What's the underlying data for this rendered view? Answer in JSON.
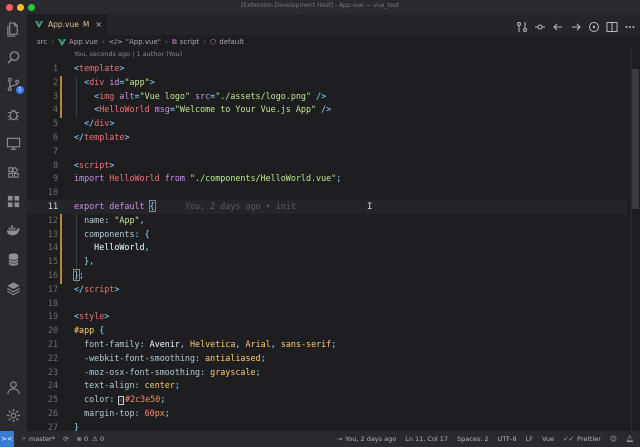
{
  "window": {
    "title": "[Extension Development Host] - App.vue — vue_test"
  },
  "colors": {
    "accent": "#3a7bd5",
    "modified": "#e2c08d",
    "git_gutter": "#b08c3a"
  },
  "activity_bar": {
    "icons": [
      "files-icon",
      "search-icon",
      "source-control-icon",
      "debug-icon",
      "remote-explorer-icon",
      "extensions-icon",
      "grid-icon",
      "docker-icon",
      "database-icon",
      "layers-icon",
      "account-icon",
      "settings-gear-icon"
    ],
    "source_control_badge": "1"
  },
  "tab": {
    "name": "App.vue",
    "modified": "M",
    "close": "×"
  },
  "breadcrumb": {
    "parts": [
      "src",
      "App.vue",
      "\"App.vue\"",
      "script",
      "default"
    ],
    "element_prefix": "</>",
    "script_icon": "⧉",
    "default_icon": "⬡"
  },
  "editor": {
    "blame_header": "You, seconds ago | 1 author (You)",
    "current_line": 11,
    "inline_blame": "You, 2 days ago • init",
    "lines": [
      {
        "n": "1",
        "tokens": [
          [
            "<",
            "t-punc"
          ],
          [
            "template",
            "t-tag"
          ],
          [
            ">",
            "t-punc"
          ]
        ]
      },
      {
        "n": "2",
        "tokens": [
          [
            "  ",
            ""
          ],
          [
            "<",
            "t-punc"
          ],
          [
            "div",
            "t-tag"
          ],
          [
            " id",
            "t-attr"
          ],
          [
            "=",
            "t-punc"
          ],
          [
            "\"app\"",
            "t-str"
          ],
          [
            ">",
            "t-punc"
          ]
        ]
      },
      {
        "n": "3",
        "tokens": [
          [
            "    ",
            ""
          ],
          [
            "<",
            "t-punc"
          ],
          [
            "img",
            "t-tag"
          ],
          [
            " alt",
            "t-attr"
          ],
          [
            "=",
            "t-punc"
          ],
          [
            "\"Vue logo\"",
            "t-str"
          ],
          [
            " src",
            "t-attr"
          ],
          [
            "=",
            "t-punc"
          ],
          [
            "\"./assets/logo.png\"",
            "t-str"
          ],
          [
            " />",
            "t-punc"
          ]
        ]
      },
      {
        "n": "4",
        "tokens": [
          [
            "    ",
            ""
          ],
          [
            "<",
            "t-punc"
          ],
          [
            "HelloWorld",
            "t-tag"
          ],
          [
            " msg",
            "t-attr"
          ],
          [
            "=",
            "t-punc"
          ],
          [
            "\"Welcome to Your Vue.js App\"",
            "t-str"
          ],
          [
            " />",
            "t-punc"
          ]
        ]
      },
      {
        "n": "5",
        "tokens": [
          [
            "  ",
            ""
          ],
          [
            "</",
            "t-punc"
          ],
          [
            "div",
            "t-tag"
          ],
          [
            ">",
            "t-punc"
          ]
        ]
      },
      {
        "n": "6",
        "tokens": [
          [
            "</",
            "t-punc"
          ],
          [
            "template",
            "t-tag"
          ],
          [
            ">",
            "t-punc"
          ]
        ]
      },
      {
        "n": "7",
        "tokens": []
      },
      {
        "n": "8",
        "tokens": [
          [
            "<",
            "t-punc"
          ],
          [
            "script",
            "t-tag"
          ],
          [
            ">",
            "t-punc"
          ]
        ]
      },
      {
        "n": "9",
        "tokens": [
          [
            "import",
            "t-kw"
          ],
          [
            " HelloWorld",
            "t-id"
          ],
          [
            " from",
            "t-kw"
          ],
          [
            " \"./components/HelloWorld.vue\"",
            "t-str"
          ],
          [
            ";",
            "t-punc"
          ]
        ]
      },
      {
        "n": "10",
        "tokens": []
      },
      {
        "n": "11",
        "tokens": [
          [
            "export",
            "t-kw"
          ],
          [
            " default",
            "t-kw"
          ],
          [
            " ",
            ""
          ],
          [
            "{",
            "t-punc bracket-hl"
          ]
        ]
      },
      {
        "n": "12",
        "tokens": [
          [
            "  ",
            ""
          ],
          [
            "name",
            "t-prop"
          ],
          [
            ": ",
            "t-punc"
          ],
          [
            "\"App\"",
            "t-str"
          ],
          [
            ",",
            "t-punc"
          ]
        ]
      },
      {
        "n": "13",
        "tokens": [
          [
            "  ",
            ""
          ],
          [
            "components",
            "t-prop"
          ],
          [
            ": ",
            "t-punc"
          ],
          [
            "{",
            "t-punc"
          ]
        ]
      },
      {
        "n": "14",
        "tokens": [
          [
            "    ",
            ""
          ],
          [
            "HelloWorld",
            "t-txt"
          ],
          [
            ",",
            "t-punc"
          ]
        ]
      },
      {
        "n": "15",
        "tokens": [
          [
            "  ",
            ""
          ],
          [
            "}",
            "t-punc"
          ],
          [
            ",",
            "t-punc"
          ]
        ]
      },
      {
        "n": "16",
        "tokens": [
          [
            "}",
            "t-punc bracket-hl"
          ],
          [
            ";",
            "t-punc"
          ]
        ]
      },
      {
        "n": "17",
        "tokens": [
          [
            "</",
            "t-punc"
          ],
          [
            "script",
            "t-tag"
          ],
          [
            ">",
            "t-punc"
          ]
        ]
      },
      {
        "n": "18",
        "tokens": []
      },
      {
        "n": "19",
        "tokens": [
          [
            "<",
            "t-punc"
          ],
          [
            "style",
            "t-tag"
          ],
          [
            ">",
            "t-punc"
          ]
        ]
      },
      {
        "n": "20",
        "tokens": [
          [
            "#app",
            "t-sel"
          ],
          [
            " {",
            "t-punc"
          ]
        ]
      },
      {
        "n": "21",
        "tokens": [
          [
            "  ",
            ""
          ],
          [
            "font-family",
            "t-prop"
          ],
          [
            ": ",
            "t-punc"
          ],
          [
            "Avenir",
            "t-txt"
          ],
          [
            ", ",
            "t-punc"
          ],
          [
            "Helvetica",
            "t-sel"
          ],
          [
            ", ",
            "t-punc"
          ],
          [
            "Arial",
            "t-sel"
          ],
          [
            ", ",
            "t-punc"
          ],
          [
            "sans-serif",
            "t-sel"
          ],
          [
            ";",
            "t-punc"
          ]
        ]
      },
      {
        "n": "22",
        "tokens": [
          [
            "  ",
            ""
          ],
          [
            "-webkit-font-smoothing",
            "t-prop"
          ],
          [
            ": ",
            "t-punc"
          ],
          [
            "antialiased",
            "t-sel"
          ],
          [
            ";",
            "t-punc"
          ]
        ]
      },
      {
        "n": "23",
        "tokens": [
          [
            "  ",
            ""
          ],
          [
            "-moz-osx-font-smoothing",
            "t-prop"
          ],
          [
            ": ",
            "t-punc"
          ],
          [
            "grayscale",
            "t-sel"
          ],
          [
            ";",
            "t-punc"
          ]
        ]
      },
      {
        "n": "24",
        "tokens": [
          [
            "  ",
            ""
          ],
          [
            "text-align",
            "t-prop"
          ],
          [
            ": ",
            "t-punc"
          ],
          [
            "center",
            "t-sel"
          ],
          [
            ";",
            "t-punc"
          ]
        ]
      },
      {
        "n": "25",
        "tokens": [
          [
            "  ",
            ""
          ],
          [
            "color",
            "t-prop"
          ],
          [
            ": ",
            "t-punc"
          ],
          [
            "■",
            "t-swatch"
          ],
          [
            "#2c3e50",
            "t-val"
          ],
          [
            ";",
            "t-punc"
          ]
        ]
      },
      {
        "n": "26",
        "tokens": [
          [
            "  ",
            ""
          ],
          [
            "margin-top",
            "t-prop"
          ],
          [
            ": ",
            "t-punc"
          ],
          [
            "60px",
            "t-val"
          ],
          [
            ";",
            "t-punc"
          ]
        ]
      },
      {
        "n": "27",
        "tokens": [
          [
            "}",
            "t-punc"
          ]
        ]
      }
    ]
  },
  "status_bar": {
    "remote": "><",
    "branch": "master*",
    "sync": "⟳",
    "errors": "0",
    "warnings": "0",
    "blame": "You, 2 days ago",
    "position": "Ln 11, Col 17",
    "spaces": "Spaces: 2",
    "encoding": "UTF-8",
    "eol": "LF",
    "language": "Vue",
    "prettier": "Prettier"
  }
}
